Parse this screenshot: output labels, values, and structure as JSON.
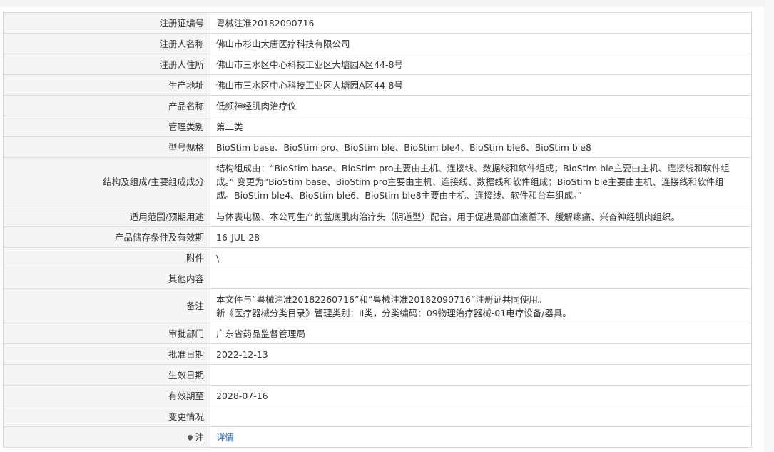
{
  "rows": [
    {
      "label": "注册证编号",
      "value": "粤械注准20182090716"
    },
    {
      "label": "注册人名称",
      "value": "佛山市杉山大唐医疗科技有限公司"
    },
    {
      "label": "注册人住所",
      "value": "佛山市三水区中心科技工业区大塘园A区44-8号"
    },
    {
      "label": "生产地址",
      "value": "佛山市三水区中心科技工业区大塘园A区44-8号"
    },
    {
      "label": "产品名称",
      "value": "低频神经肌肉治疗仪"
    },
    {
      "label": "管理类别",
      "value": "第二类"
    },
    {
      "label": "型号规格",
      "value": "BioStim base、BioStim pro、BioStim ble、BioStim ble4、BioStim ble6、BioStim ble8"
    },
    {
      "label": "结构及组成/主要组成成分",
      "value": "结构组成由：“BioStim base、BioStim pro主要由主机、连接线、数据线和软件组成；BioStim ble主要由主机、连接线和软件组成。” 变更为“BioStim base、BioStim pro主要由主机、连接线、数据线和软件组成；BioStim ble主要由主机、连接线和软件组成。BioStim ble4、BioStim ble6、BioStim ble8主要由主机、连接线、软件和台车组成。”"
    },
    {
      "label": "适用范围/预期用途",
      "value": "与体表电极、本公司生产的盆底肌肉治疗头（阴道型）配合，用于促进局部血液循环、缓解疼痛、兴奋神经肌肉组织。"
    },
    {
      "label": "产品储存条件及有效期",
      "value": "16-JUL-28"
    },
    {
      "label": "附件",
      "value": "\\"
    },
    {
      "label": "其他内容",
      "value": ""
    },
    {
      "label": "备注",
      "value": "本文件与“粤械注准20182260716”和“粤械注准20182090716”注册证共同使用。\n新《医疗器械分类目录》管理类别：II类，分类编码：09物理治疗器械-01电疗设备/器具。"
    },
    {
      "label": "审批部门",
      "value": "广东省药品监督管理局"
    },
    {
      "label": "批准日期",
      "value": "2022-12-13"
    },
    {
      "label": "生效日期",
      "value": ""
    },
    {
      "label": "有效期至",
      "value": "2028-07-16"
    },
    {
      "label": "变更情况",
      "value": ""
    },
    {
      "label": "注",
      "value": "详情"
    }
  ],
  "icons": {
    "note_icon": "map-pin-icon"
  },
  "colors": {
    "link": "#2a6fb3",
    "label_bg": "#f5f5f5",
    "border": "#d9d9d9"
  }
}
